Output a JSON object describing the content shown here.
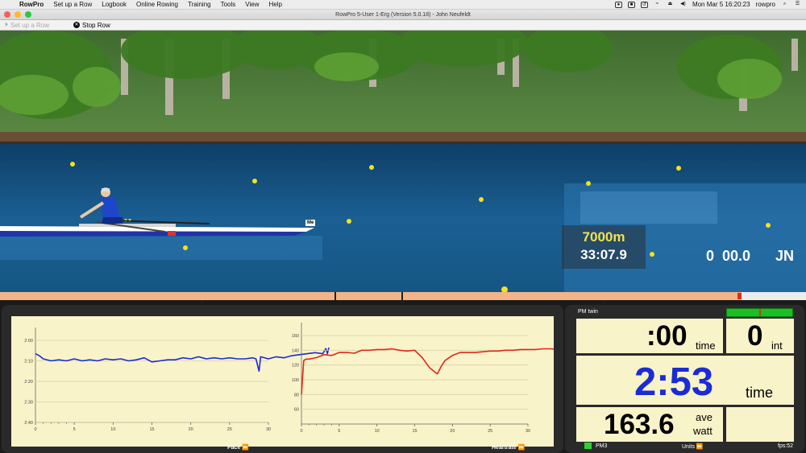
{
  "menubar": {
    "items": [
      "RowPro",
      "Set up a Row",
      "Logbook",
      "Online Rowing",
      "Training",
      "Tools",
      "View",
      "Help"
    ],
    "clock": "Mon Mar 5  16:20:23",
    "user": "rowpro"
  },
  "window": {
    "title": "RowPro 5-User 1-Erg (Version 5.0.18) - John Neufeldt"
  },
  "toolbar": {
    "setup_label": "Set up a Row",
    "stop_label": "Stop Row"
  },
  "scene": {
    "distance": "7000m",
    "elapsed": "33:07.9",
    "score": "0  00.0",
    "initials": "JN",
    "boat_tag": "Me"
  },
  "progress": {
    "filled_fraction": 0.92
  },
  "graphs": {
    "pace_label": "Pace",
    "hr_label": "Heartrate",
    "pace_yticks": [
      "2:00",
      "2:10",
      "2:20",
      "2:30",
      "2:40"
    ],
    "hr_yticks": [
      "160",
      "140",
      "120",
      "100",
      "80",
      "60",
      "40"
    ],
    "xticks": [
      "0",
      "5",
      "10",
      "15",
      "20",
      "25",
      "30"
    ]
  },
  "pm": {
    "title": "PM twin",
    "interval_time_value": ":00",
    "interval_time_unit": "time",
    "int_value": "0",
    "int_unit": "int",
    "pace_value": "2:53",
    "pace_unit": "time",
    "watt_value": "163.6",
    "watt_unit_1": "ave",
    "watt_unit_2": "watt",
    "pm3_label": "PM3",
    "units_label": "Units",
    "fps_label": "fps:52",
    "pace_color": "#1a2bd9"
  },
  "chart_data": [
    {
      "type": "line",
      "title": "Pace",
      "xlabel": "",
      "ylabel": "",
      "ylim": [
        "2:00",
        "2:40"
      ],
      "xlim": [
        0,
        30
      ],
      "series": [
        {
          "x": [
            0,
            0.5,
            1,
            2,
            3,
            4,
            5,
            6,
            7,
            8,
            9,
            10,
            11,
            12,
            13,
            14,
            15,
            16,
            17,
            18,
            19,
            20,
            21,
            22,
            23,
            24,
            25,
            26,
            27,
            28,
            28.4,
            28.8,
            29,
            30,
            31,
            32,
            32.5,
            33,
            34,
            35,
            36,
            37,
            37.4,
            37.6,
            37.8
          ],
          "y": [
            126.5,
            127.5,
            129,
            130,
            129.5,
            130,
            129,
            130,
            129.5,
            130,
            129,
            129.5,
            129,
            130,
            129.5,
            128.5,
            130.5,
            130,
            129.5,
            129.5,
            128.5,
            129,
            128,
            129,
            128.5,
            129,
            128.5,
            129,
            129,
            128.5,
            129,
            135,
            128,
            129,
            128,
            128.5,
            128,
            127.5,
            127,
            126.5,
            126,
            126.5,
            124,
            126.5,
            123.5
          ]
        }
      ]
    },
    {
      "type": "line",
      "title": "Heartrate",
      "xlabel": "",
      "ylabel": "",
      "ylim": [
        40,
        160
      ],
      "xlim": [
        0,
        30
      ],
      "series": [
        {
          "x": [
            0,
            0.3,
            0.6,
            1,
            2,
            3,
            4,
            5,
            6,
            7,
            8,
            9,
            10,
            11,
            12,
            13,
            14,
            15,
            16,
            17,
            18,
            18.5,
            19,
            20,
            21,
            22,
            23,
            24,
            25,
            26,
            27,
            28,
            29,
            30,
            31,
            32,
            33,
            34,
            35,
            36,
            37,
            38,
            39,
            40,
            41
          ],
          "y": [
            80,
            126,
            128,
            128,
            130,
            134,
            133,
            137,
            137,
            136,
            140,
            140,
            141,
            141,
            142,
            140,
            139,
            140,
            130,
            116,
            108,
            118,
            126,
            133,
            137,
            137,
            137,
            138,
            139,
            139,
            140,
            140,
            141,
            141,
            141,
            142,
            142,
            141,
            142,
            141,
            140,
            143,
            144,
            145,
            150
          ]
        }
      ]
    }
  ]
}
